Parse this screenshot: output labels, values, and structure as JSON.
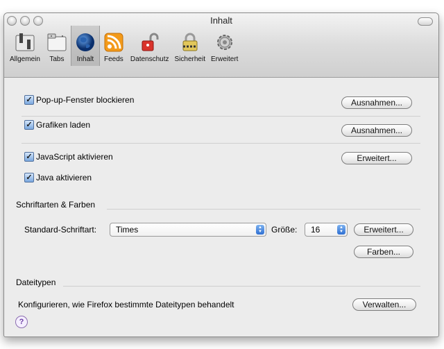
{
  "window": {
    "title": "Inhalt"
  },
  "toolbar": [
    {
      "label": "Allgemein",
      "icon": "switch-icon"
    },
    {
      "label": "Tabs",
      "icon": "tabs-icon"
    },
    {
      "label": "Inhalt",
      "icon": "globe-icon"
    },
    {
      "label": "Feeds",
      "icon": "rss-icon"
    },
    {
      "label": "Datenschutz",
      "icon": "unlocked-padlock-icon"
    },
    {
      "label": "Sicherheit",
      "icon": "padlock-icon"
    },
    {
      "label": "Erweitert",
      "icon": "gear-icon"
    }
  ],
  "content": {
    "popup": {
      "label": "Pop-up-Fenster blockieren",
      "checked": true,
      "button": "Ausnahmen..."
    },
    "images": {
      "label": "Grafiken laden",
      "checked": true,
      "button": "Ausnahmen..."
    },
    "javascript": {
      "label": "JavaScript aktivieren",
      "checked": true,
      "button": "Erweitert..."
    },
    "java": {
      "label": "Java aktivieren",
      "checked": true
    },
    "fonts": {
      "section": "Schriftarten & Farben",
      "default_font_label": "Standard-Schriftart:",
      "default_font_value": "Times",
      "size_label": "Größe:",
      "size_value": "16",
      "advanced_button": "Erweitert...",
      "colors_button": "Farben..."
    },
    "filetypes": {
      "section": "Dateitypen",
      "description": "Konfigurieren, wie Firefox bestimmte Dateitypen behandelt",
      "manage_button": "Verwalten..."
    },
    "help_symbol": "?"
  }
}
